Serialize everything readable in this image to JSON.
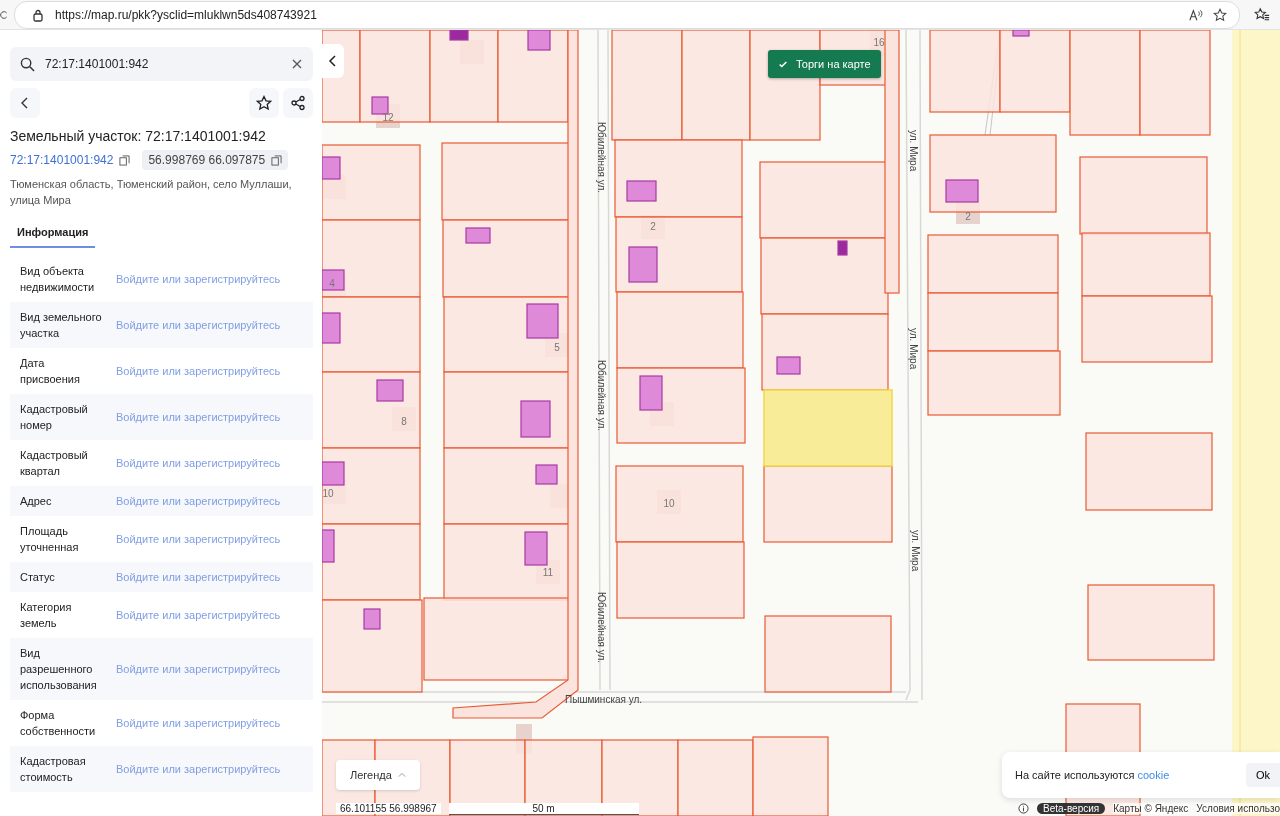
{
  "browser": {
    "url": "https://map.ru/pkk?ysclid=mluklwn5ds408743921"
  },
  "panel": {
    "search": {
      "value": "72:17:1401001:942"
    },
    "title": "Земельный участок: 72:17:1401001:942",
    "cadastral_number": "72:17:1401001:942",
    "coordinates": "56.998769 66.097875",
    "address": "Тюменская область, Тюменский район, село Муллаши, улица Мира",
    "tabs": [
      {
        "label": "Информация",
        "selected": true
      }
    ],
    "rows": [
      {
        "label": "Вид объекта недвижимости",
        "value": "Войдите или зарегистрируйтесь"
      },
      {
        "label": "Вид земельного участка",
        "value": "Войдите или зарегистрируйтесь"
      },
      {
        "label": "Дата присвоения",
        "value": "Войдите или зарегистрируйтесь"
      },
      {
        "label": "Кадастровый номер",
        "value": "Войдите или зарегистрируйтесь"
      },
      {
        "label": "Кадастровый квартал",
        "value": "Войдите или зарегистрируйтесь"
      },
      {
        "label": "Адрес",
        "value": "Войдите или зарегистрируйтесь"
      },
      {
        "label": "Площадь уточненная",
        "value": "Войдите или зарегистрируйтесь"
      },
      {
        "label": "Статус",
        "value": "Войдите или зарегистрируйтесь"
      },
      {
        "label": "Категория земель",
        "value": "Войдите или зарегистрируйтесь"
      },
      {
        "label": "Вид разрешенного использования",
        "value": "Войдите или зарегистрируйтесь"
      },
      {
        "label": "Форма собственности",
        "value": "Войдите или зарегистрируйтесь"
      },
      {
        "label": "Кадастровая стоимость",
        "value": "Войдите или зарегистрируйтесь"
      }
    ]
  },
  "map": {
    "trade_button": {
      "label": "Торги на карте",
      "checked": true
    },
    "labels": [
      {
        "kind": "house",
        "text": "16"
      },
      {
        "kind": "house",
        "text": "12"
      },
      {
        "kind": "street",
        "text": "Юбилейная ул."
      },
      {
        "kind": "house",
        "text": "2"
      },
      {
        "kind": "street",
        "text": "ул. Мира"
      },
      {
        "kind": "house",
        "text": "2"
      },
      {
        "kind": "house",
        "text": "4"
      },
      {
        "kind": "street",
        "text": "ул. Мира"
      },
      {
        "kind": "house",
        "text": "5"
      },
      {
        "kind": "street",
        "text": "Юбилейная ул."
      },
      {
        "kind": "house",
        "text": "8"
      },
      {
        "kind": "house",
        "text": "10"
      },
      {
        "kind": "house",
        "text": "10"
      },
      {
        "kind": "street",
        "text": "ул. Мира"
      },
      {
        "kind": "house",
        "text": "11"
      },
      {
        "kind": "street",
        "text": "Юбилейная ул."
      },
      {
        "kind": "street",
        "text": "Пышминская ул."
      }
    ],
    "legend": {
      "label": "Легенда"
    },
    "cookie": {
      "text": "На сайте используются",
      "link": "cookie",
      "button": "Ok"
    },
    "footer": {
      "coords": "66.101155 56.998967",
      "scale": "50 m",
      "beta": "Beta-версия",
      "copyright": "Карты © Яндекс",
      "terms": "Условия использо"
    }
  }
}
